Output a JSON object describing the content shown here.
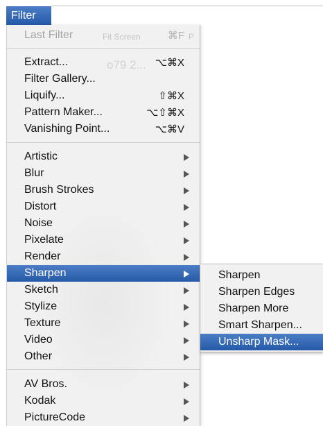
{
  "menu_title": "Filter",
  "background_text": {
    "top_left": "Fit Screen",
    "top_right": "P",
    "faded": "o79 2..."
  },
  "items": [
    {
      "label": "Last Filter",
      "shortcut": "⌘F",
      "disabled": true
    },
    {
      "label": "Extract...",
      "shortcut": "⌥⌘X"
    },
    {
      "label": "Filter Gallery..."
    },
    {
      "label": "Liquify...",
      "shortcut": "⇧⌘X"
    },
    {
      "label": "Pattern Maker...",
      "shortcut": "⌥⇧⌘X"
    },
    {
      "label": "Vanishing Point...",
      "shortcut": "⌥⌘V"
    },
    {
      "label": "Artistic",
      "submenu": true
    },
    {
      "label": "Blur",
      "submenu": true
    },
    {
      "label": "Brush Strokes",
      "submenu": true
    },
    {
      "label": "Distort",
      "submenu": true
    },
    {
      "label": "Noise",
      "submenu": true
    },
    {
      "label": "Pixelate",
      "submenu": true
    },
    {
      "label": "Render",
      "submenu": true
    },
    {
      "label": "Sharpen",
      "submenu": true,
      "selected": true
    },
    {
      "label": "Sketch",
      "submenu": true
    },
    {
      "label": "Stylize",
      "submenu": true
    },
    {
      "label": "Texture",
      "submenu": true
    },
    {
      "label": "Video",
      "submenu": true
    },
    {
      "label": "Other",
      "submenu": true
    },
    {
      "label": "AV Bros.",
      "submenu": true
    },
    {
      "label": "Kodak",
      "submenu": true
    },
    {
      "label": "PictureCode",
      "submenu": true
    }
  ],
  "submenu": {
    "parent": "Sharpen",
    "items": [
      {
        "label": "Sharpen"
      },
      {
        "label": "Sharpen Edges"
      },
      {
        "label": "Sharpen More"
      },
      {
        "label": "Smart Sharpen..."
      },
      {
        "label": "Unsharp Mask...",
        "selected": true
      }
    ]
  },
  "colors": {
    "selection": "#2f63b3",
    "menu_background": "#f1f1f1",
    "disabled_text": "#a3a3a3",
    "arrow": "#555555"
  },
  "icons": {
    "submenu_indicator": "triangle-right-icon"
  }
}
